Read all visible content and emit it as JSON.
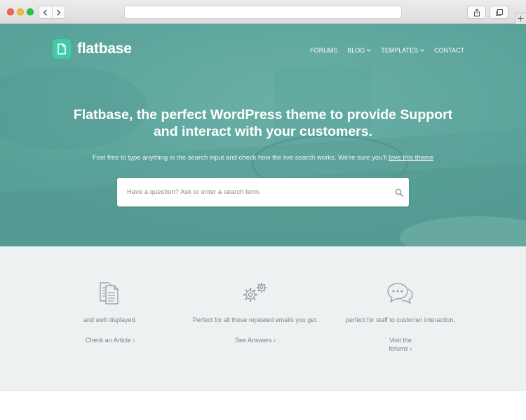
{
  "browser": {
    "url": "",
    "icons": [
      "back-icon",
      "forward-icon",
      "share-icon",
      "tabs-icon",
      "new-tab-icon"
    ]
  },
  "site": {
    "name": "flatbase",
    "brand_color": "#3fcca6",
    "hero_color": "#57a198"
  },
  "nav": {
    "items": [
      {
        "label": "FORUMS",
        "has_dropdown": false
      },
      {
        "label": "BLOG",
        "has_dropdown": true
      },
      {
        "label": "TEMPLATES",
        "has_dropdown": true
      },
      {
        "label": "CONTACT",
        "has_dropdown": false
      }
    ]
  },
  "hero": {
    "headline_line1": "Flatbase, the perfect WordPress theme to provide Support",
    "headline_line2": "and interact with your customers.",
    "subline_text": "Feel free to type anything in the search input and check how the live search works. We're sure you'll ",
    "subline_link": "love this theme"
  },
  "search": {
    "placeholder": "Have a question? Ask or enter a search term.",
    "value": ""
  },
  "features": [
    {
      "icon": "documents-icon",
      "description": "and well displayed.",
      "link": "Check an Article ›"
    },
    {
      "icon": "gears-icon",
      "description": "Perfect for all those repeated emails you get.",
      "link": "See Answers ›"
    },
    {
      "icon": "chat-bubbles-icon",
      "description": "perfect for staff to customer interaction.",
      "link_line1": "Visit the",
      "link_line2": "forums ›"
    }
  ]
}
